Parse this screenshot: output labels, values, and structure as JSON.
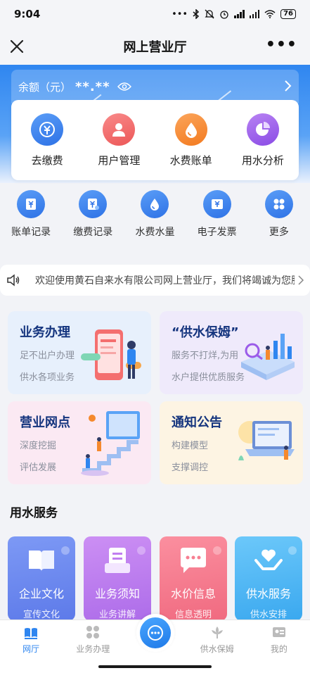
{
  "status_bar": {
    "time": "9:04",
    "battery": "76"
  },
  "nav": {
    "title": "网上营业厅",
    "more": "•••"
  },
  "balance": {
    "label": "余额（元）",
    "amount": "**.**"
  },
  "main_functions": [
    {
      "label": "去缴费",
      "icon": "pay-icon",
      "color": "#3d84ee"
    },
    {
      "label": "用户管理",
      "icon": "user-icon",
      "color": "#f26a6a"
    },
    {
      "label": "水费账单",
      "icon": "water-drop-icon",
      "color": "#f5892d"
    },
    {
      "label": "用水分析",
      "icon": "pie-chart-icon",
      "color": "#9b5ce9"
    }
  ],
  "sub_functions": [
    {
      "label": "账单记录",
      "icon": "bill-record-icon"
    },
    {
      "label": "缴费记录",
      "icon": "payment-record-icon"
    },
    {
      "label": "水费水量",
      "icon": "water-volume-icon"
    },
    {
      "label": "电子发票",
      "icon": "invoice-icon"
    },
    {
      "label": "更多",
      "icon": "more-grid-icon"
    }
  ],
  "notice": {
    "text": "欢迎使用黄石自来水有限公司网上营业厅，我们将竭诚为您服务"
  },
  "promos": [
    {
      "title": "业务办理",
      "line1": "足不出户办理",
      "line2": "供水各项业务",
      "bg": "#e7f0fc"
    },
    {
      "title": "“供水保姆”",
      "line1": "服务不打烊,为用",
      "line2": "水户提供优质服务",
      "bg": "#efeafb"
    },
    {
      "title": "营业网点",
      "line1": "深度挖掘",
      "line2": "评估发展",
      "bg": "#fbe9f3"
    },
    {
      "title": "通知公告",
      "line1": "构建模型",
      "line2": "支撑调控",
      "bg": "#fdf4e3"
    }
  ],
  "section": {
    "title": "用水服务"
  },
  "services": [
    {
      "title": "企业文化",
      "sub": "宣传文化",
      "icon": "book-icon",
      "color": "#6f8cf2"
    },
    {
      "title": "业务须知",
      "sub": "业务讲解",
      "icon": "document-icon",
      "color": "#c07ef0"
    },
    {
      "title": "水价信息",
      "sub": "信息透明",
      "icon": "chat-bubble-icon",
      "color": "#f77f92"
    },
    {
      "title": "供水服务",
      "sub": "供水安排",
      "icon": "heart-hands-icon",
      "color": "#4ab8f5"
    }
  ],
  "tabs": [
    {
      "label": "网厅",
      "icon": "home-book-icon",
      "active": true
    },
    {
      "label": "业务办理",
      "icon": "business-grid-icon",
      "active": false
    },
    {
      "label": "供水保姆",
      "icon": "lotus-icon",
      "active": false
    },
    {
      "label": "我的",
      "icon": "profile-card-icon",
      "active": false
    }
  ],
  "colors": {
    "primary": "#2f86f0",
    "title_dark": "#14347e"
  }
}
